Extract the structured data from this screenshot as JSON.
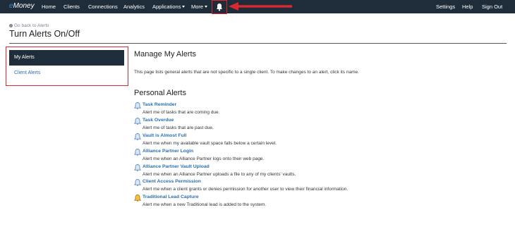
{
  "nav": {
    "brand_prefix": "e",
    "brand_suffix": "Money",
    "items": [
      "Home",
      "Clients",
      "Connections",
      "Analytics",
      "Applications",
      "More"
    ],
    "right": [
      "Settings",
      "Help",
      "Sign Out"
    ]
  },
  "header": {
    "go_back": "Go back to Alerts",
    "title": "Turn Alerts On/Off"
  },
  "sidebar": {
    "items": [
      {
        "label": "My Alerts",
        "active": true
      },
      {
        "label": "Client Alerts",
        "active": false
      }
    ]
  },
  "main": {
    "heading": "Manage My Alerts",
    "description": "This page lists general alerts that are not specific to a single client. To make changes to an alert, click its name.",
    "section_heading": "Personal Alerts",
    "alerts": [
      {
        "name": "Task Reminder",
        "desc": "Alert me of tasks that are coming due.",
        "icon": "bell-icon"
      },
      {
        "name": "Task Overdue",
        "desc": "Alert me of tasks that are past due.",
        "icon": "bell-icon"
      },
      {
        "name": "Vault is Almost Full",
        "desc": "Alert me when my available vault space falls below a certain level.",
        "icon": "bell-icon"
      },
      {
        "name": "Alliance Partner Login",
        "desc": "Alert me when an Alliance Partner logs onto their web page.",
        "icon": "bell-icon"
      },
      {
        "name": "Alliance Partner Vault Upload",
        "desc": "Alert me when an Alliance Partner uploads a file to any of my clients' vaults.",
        "icon": "bell-icon"
      },
      {
        "name": "Client Access Permission",
        "desc": "Alert me when a client grants or denies permission for another user to view their financial information.",
        "icon": "bell-icon"
      },
      {
        "name": "Traditional Lead Capture",
        "desc": "Alert me when a new Traditional lead is added to the system.",
        "icon": "bell-icon-active"
      }
    ]
  },
  "colors": {
    "nav_bg": "#1f2d3a",
    "link": "#2a6fb0",
    "highlight_red": "#d9282f",
    "bell_blue": "#5b8fc7",
    "bell_gold": "#e0a020"
  }
}
